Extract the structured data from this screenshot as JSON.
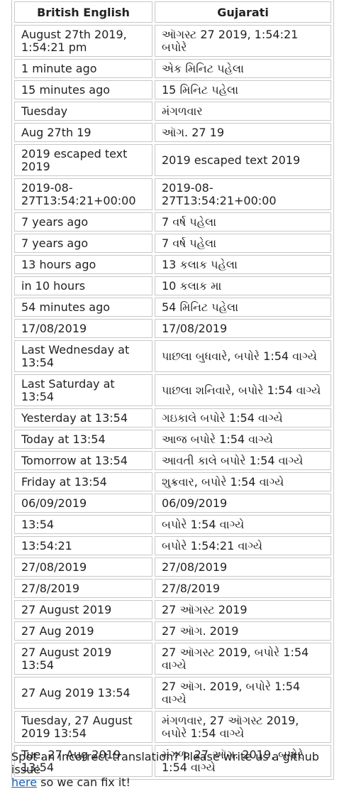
{
  "table": {
    "headers": [
      "British English",
      "Gujarati"
    ],
    "rows": [
      [
        "August 27th 2019, 1:54:21 pm",
        "ઑગસ્ટ 27 2019, 1:54:21 બપોરે"
      ],
      [
        "1 minute ago",
        "એક મિનિટ પહેલા"
      ],
      [
        "15 minutes ago",
        "15 મિનિટ પહેલા"
      ],
      [
        "Tuesday",
        "મંગળવાર"
      ],
      [
        "Aug 27th 19",
        "ઑગ. 27 19"
      ],
      [
        "2019 escaped text 2019",
        "2019 escaped text 2019"
      ],
      [
        "2019-08-27T13:54:21+00:00",
        "2019-08-27T13:54:21+00:00"
      ],
      [
        "7 years ago",
        "7 વર્ષ પહેલા"
      ],
      [
        "7 years ago",
        "7 વર્ષ પહેલા"
      ],
      [
        "13 hours ago",
        "13 કલાક પહેલા"
      ],
      [
        "in 10 hours",
        "10 કલાક મા"
      ],
      [
        "54 minutes ago",
        "54 મિનિટ પહેલા"
      ],
      [
        "17/08/2019",
        "17/08/2019"
      ],
      [
        "Last Wednesday at 13:54",
        "પાછલા બુધવારે, બપોરે 1:54 વાગ્યે"
      ],
      [
        "Last Saturday at 13:54",
        "પાછલા શનિવારે, બપોરે 1:54 વાગ્યે"
      ],
      [
        "Yesterday at 13:54",
        "ગઇકાલે બપોરે 1:54 વાગ્યે"
      ],
      [
        "Today at 13:54",
        "આજ બપોરે 1:54 વાગ્યે"
      ],
      [
        "Tomorrow at 13:54",
        "આવતી કાલે બપોરે 1:54 વાગ્યે"
      ],
      [
        "Friday at 13:54",
        "શુક્રવાર, બપોરે 1:54 વાગ્યે"
      ],
      [
        "06/09/2019",
        "06/09/2019"
      ],
      [
        "13:54",
        "બપોરે 1:54 વાગ્યે"
      ],
      [
        "13:54:21",
        "બપોરે 1:54:21 વાગ્યે"
      ],
      [
        "27/08/2019",
        "27/08/2019"
      ],
      [
        "27/8/2019",
        "27/8/2019"
      ],
      [
        "27 August 2019",
        "27 ઑગસ્ટ 2019"
      ],
      [
        "27 Aug 2019",
        "27 ઑગ. 2019"
      ],
      [
        "27 August 2019 13:54",
        "27 ઑગસ્ટ 2019, બપોરે 1:54 વાગ્યે"
      ],
      [
        "27 Aug 2019 13:54",
        "27 ઑગ. 2019, બપોરે 1:54 વાગ્યે"
      ],
      [
        "Tuesday, 27 August 2019 13:54",
        "મંગળવાર, 27 ઑગસ્ટ 2019, બપોરે 1:54 વાગ્યે"
      ],
      [
        "Tue, 27 Aug 2019 13:54",
        "મંગળ, 27 ઑગ. 2019, બપોરે 1:54 વાગ્યે"
      ]
    ]
  },
  "footer": {
    "text_before": "Spot an incorrect translation? Please write us a github issue",
    "link_text": "here",
    "text_after": " so we can fix it!"
  },
  "colors": {
    "border": "#c8c8c8",
    "link": "#1a5fb4",
    "text": "#222222"
  }
}
